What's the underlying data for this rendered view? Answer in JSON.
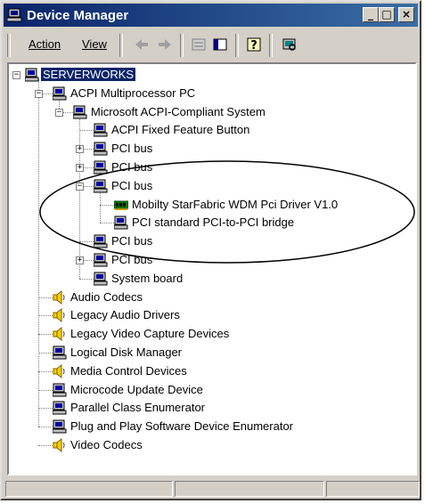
{
  "window": {
    "title": "Device Manager"
  },
  "title_buttons": {
    "minimize": "_",
    "maximize": "□",
    "close": "×"
  },
  "menu": {
    "action": "Action",
    "view": "View"
  },
  "toolbar_icons": [
    "back-arrow-icon",
    "forward-arrow-icon",
    "properties-icon",
    "show-hide-tree-icon",
    "help-icon",
    "scan-hardware-icon"
  ],
  "tree": {
    "root": "SERVERWORKS",
    "items": [
      {
        "label": "ACPI Multiprocessor PC"
      },
      {
        "label": "Microsoft ACPI-Compliant System"
      },
      {
        "label": "ACPI Fixed Feature Button"
      },
      {
        "label": "PCI bus"
      },
      {
        "label": "PCI bus"
      },
      {
        "label": "PCI bus"
      },
      {
        "label": "Mobilty StarFabric WDM Pci Driver V1.0"
      },
      {
        "label": "PCI standard PCI-to-PCI bridge"
      },
      {
        "label": "PCI bus"
      },
      {
        "label": "PCI bus"
      },
      {
        "label": "System board"
      },
      {
        "label": "Audio Codecs"
      },
      {
        "label": "Legacy Audio Drivers"
      },
      {
        "label": "Legacy Video Capture Devices"
      },
      {
        "label": "Logical Disk Manager"
      },
      {
        "label": "Media Control Devices"
      },
      {
        "label": "Microcode Update Device"
      },
      {
        "label": "Parallel Class Enumerator"
      },
      {
        "label": "Plug and Play Software Device Enumerator"
      },
      {
        "label": "Video Codecs"
      }
    ]
  },
  "colors": {
    "titlebar": "#0a246a",
    "selection": "#0a246a",
    "window": "#d4d0c8",
    "annotation": "#000000"
  }
}
